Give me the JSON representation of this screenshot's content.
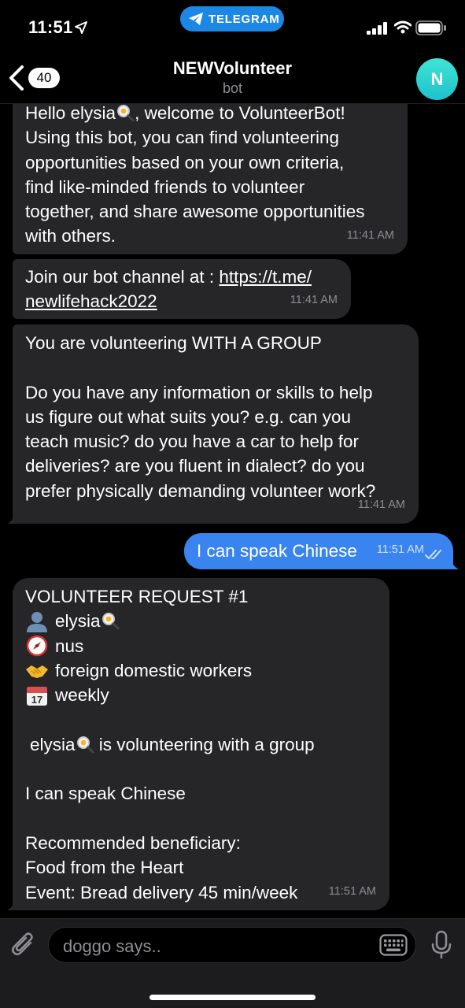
{
  "status": {
    "time": "11:51",
    "app_pill": "TELEGRAM"
  },
  "header": {
    "back_count": "40",
    "title": "NEWVolunteer",
    "subtitle": "bot",
    "avatar_initial": "N"
  },
  "messages": [
    {
      "direction": "incoming",
      "text_lines": [
        "Hello elysia",
        ", welcome to VolunteerBot!",
        "Using this bot, you can find volunteering",
        "opportunities based on your own criteria,",
        "find like-minded friends to volunteer",
        "together, and share awesome opportunities",
        "with others."
      ],
      "time": "11:41 AM"
    },
    {
      "direction": "incoming",
      "prefix": "Join our bot channel at : ",
      "link_line1": "https://t.me/",
      "link_line2": "newlifehack2022",
      "time": "11:41 AM"
    },
    {
      "direction": "incoming",
      "text": "You are volunteering WITH A GROUP\n\nDo you have any information or skills to help\nus figure out what suits you? e.g. can you\nteach music? do you have a car to help for\ndeliveries? are you fluent in dialect? do you\nprefer physically demanding volunteer work?",
      "time": "11:41 AM"
    },
    {
      "direction": "outgoing",
      "text": "I can speak Chinese",
      "time": "11:51 AM",
      "status": "read"
    },
    {
      "direction": "incoming",
      "heading": "VOLUNTEER REQUEST #1",
      "rows": [
        {
          "icon": "user-silhouette-icon",
          "text": "elysia"
        },
        {
          "icon": "compass-icon",
          "text": "nus"
        },
        {
          "icon": "handshake-icon",
          "text": "foreign domestic workers"
        },
        {
          "icon": "calendar-icon",
          "text": "weekly",
          "calendar_day": "17"
        }
      ],
      "group_line_name": "elysia",
      "group_line_rest": " is volunteering with a group",
      "skill_line": "I can speak Chinese",
      "rec_label": "Recommended beneficiary:",
      "rec_org": "Food from the Heart",
      "rec_event": "Event: Bread delivery 45 min/week",
      "time": "11:51 AM"
    }
  ],
  "input": {
    "placeholder": "doggo says.."
  },
  "colors": {
    "background": "#000000",
    "incoming_bubble": "#262628",
    "outgoing_bubble": "#3a84f0",
    "telegram_pill": "#1d87e6",
    "avatar": "#2fd3d0"
  }
}
